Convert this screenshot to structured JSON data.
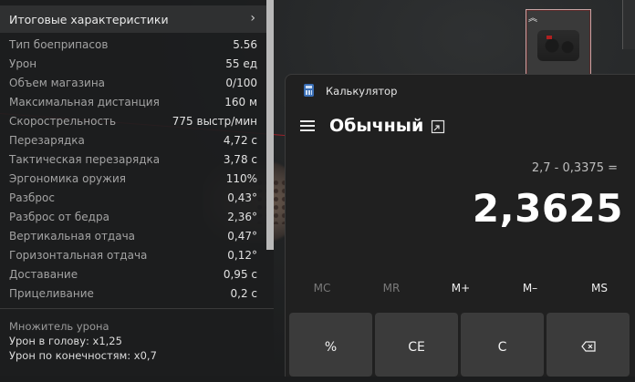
{
  "stats": {
    "header_title": "Итоговые характеристики",
    "header_chevron": "›",
    "rows": [
      {
        "label": "Тип боеприпасов",
        "value": "5.56"
      },
      {
        "label": "Урон",
        "value": "55 ед"
      },
      {
        "label": "Объем магазина",
        "value": "0/100"
      },
      {
        "label": "Максимальная дистанция",
        "value": "160 м"
      },
      {
        "label": "Скорострельность",
        "value": "775 выстр/мин"
      },
      {
        "label": "Перезарядка",
        "value": "4,72 с"
      },
      {
        "label": "Тактическая перезарядка",
        "value": "3,78 с"
      },
      {
        "label": "Эргономика оружия",
        "value": "110%"
      },
      {
        "label": "Разброс",
        "value": "0,43°"
      },
      {
        "label": "Разброс от бедра",
        "value": "2,36°"
      },
      {
        "label": "Вертикальная отдача",
        "value": "0,47°"
      },
      {
        "label": "Горизонтальная отдача",
        "value": "0,12°"
      },
      {
        "label": "Доставание",
        "value": "0,95 с"
      },
      {
        "label": "Прицеливание",
        "value": "0,2 с"
      }
    ],
    "multiplier": {
      "title": "Множитель урона",
      "head": "Урон в голову: x1,25",
      "limbs": "Урон по конечностям: x0,7"
    }
  },
  "calculator": {
    "window_title": "Калькулятор",
    "mode": "Обычный",
    "expression": "2,7 - 0,3375 =",
    "result": "2,3625",
    "memory": [
      {
        "label": "MC",
        "enabled": false
      },
      {
        "label": "MR",
        "enabled": false
      },
      {
        "label": "M+",
        "enabled": true
      },
      {
        "label": "M–",
        "enabled": true
      },
      {
        "label": "MS",
        "enabled": true
      }
    ],
    "keys": [
      {
        "label": "%"
      },
      {
        "label": "CE"
      },
      {
        "label": "C"
      },
      {
        "label": "⌫",
        "icon": "backspace-icon"
      }
    ]
  },
  "colors": {
    "accent_red": "#b0202a",
    "calc_bg": "#202020",
    "key_bg": "#3b3b3b"
  }
}
